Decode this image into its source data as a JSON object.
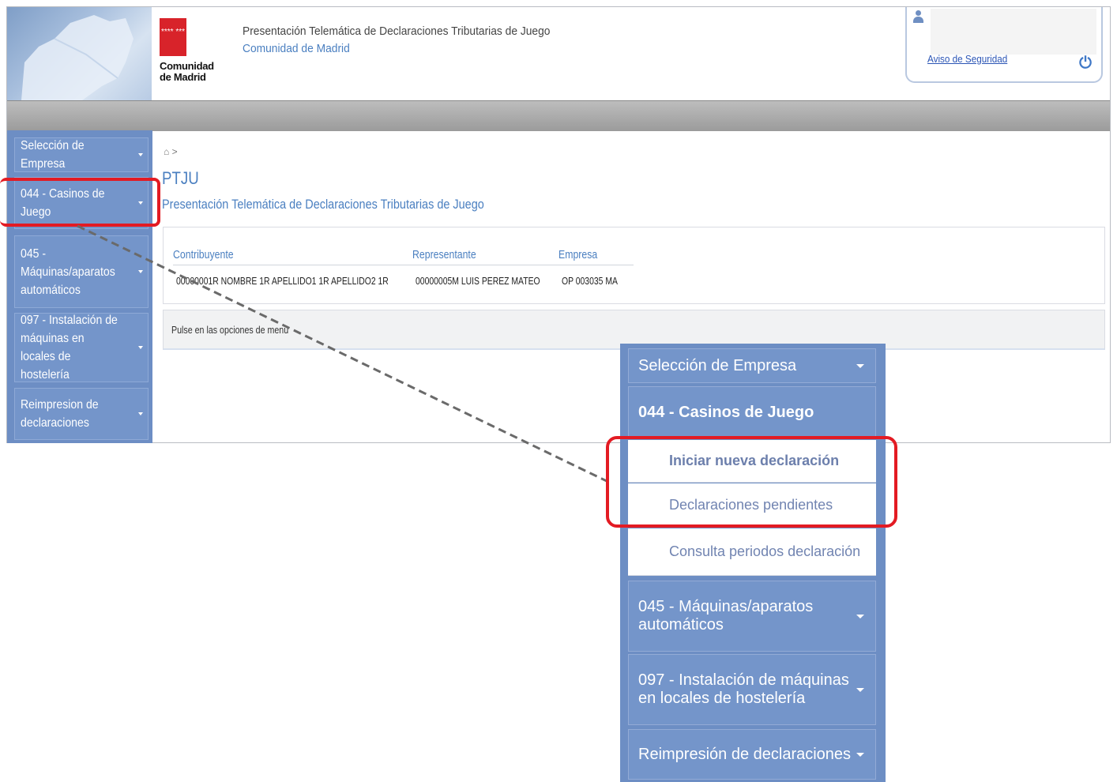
{
  "header": {
    "title": "Presentación Telemática de Declaraciones Tributarias de Juego",
    "subtitle": "Comunidad de Madrid",
    "logo_stars": "****\n***",
    "logo_text_line1": "Comunidad",
    "logo_text_line2": "de Madrid",
    "security_link": "Aviso de Seguridad",
    "power_icon": "power-icon"
  },
  "sidebar": {
    "items": [
      {
        "label": "Selección de Empresa"
      },
      {
        "label": "044 - Casinos de Juego"
      },
      {
        "label": "045 - Máquinas/aparatos automáticos"
      },
      {
        "label": "097 - Instalación de máquinas en locales de hostelería"
      },
      {
        "label": "Reimpresion de declaraciones"
      }
    ]
  },
  "main": {
    "breadcrumb_sep": ">",
    "page_title": "PTJU",
    "page_subtitle": "Presentación Telemática de Declaraciones Tributarias de Juego",
    "table": {
      "headers": [
        "Contribuyente",
        "Representante",
        "Empresa"
      ],
      "row": {
        "contribuyente": "00000001R  NOMBRE 1R APELLIDO1 1R APELLIDO2 1R",
        "representante": "00000005M  LUIS PEREZ MATEO",
        "empresa": "OP  003035  MA"
      }
    },
    "message": "Pulse en las opciones de menú"
  },
  "zoom_menu": {
    "items": [
      {
        "label": "Selección de Empresa"
      },
      {
        "label": "044 - Casinos de Juego"
      },
      {
        "label": "045 - Máquinas/aparatos automáticos"
      },
      {
        "label": "097 - Instalación de máquinas en locales de hostelería"
      },
      {
        "label": "Reimpresión de declaraciones"
      }
    ],
    "subitems": [
      {
        "label": "Iniciar nueva declaración"
      },
      {
        "label": "Declaraciones pendientes"
      },
      {
        "label": "Consulta periodos declaración"
      }
    ]
  },
  "colors": {
    "accent_blue": "#4a7fc0",
    "menu_blue": "#7495ca",
    "highlight_red": "#e31b23"
  }
}
